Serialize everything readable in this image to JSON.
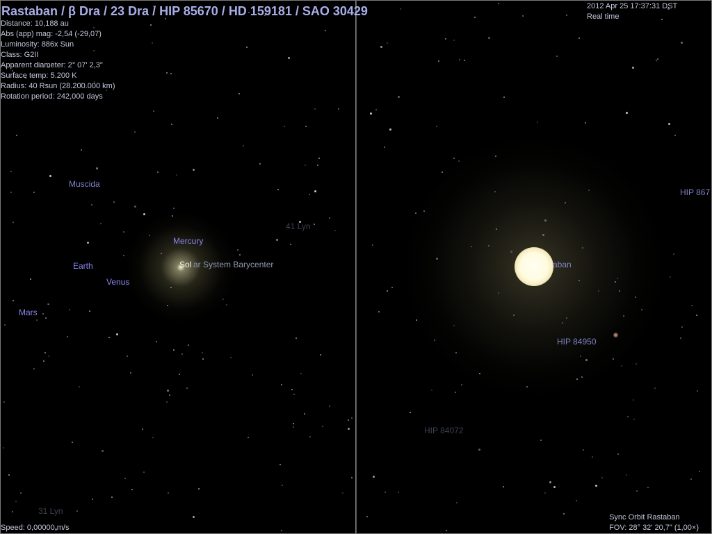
{
  "title": "Rastaban / β Dra / 23 Dra / HIP 85670 / HD 159181 / SAO 30429",
  "info": {
    "distance": "Distance: 10,188 au",
    "magnitude": "Abs (app) mag: -2,54 (-29,07)",
    "luminosity": "Luminosity: 886x Sun",
    "class": "Class: G2II",
    "apparent_diameter": "Apparent diameter: 2° 07' 2,3\"",
    "surface_temp": "Surface temp: 5.200 K",
    "radius": "Radius: 40 Rsun  (28.200.000 km)",
    "rotation_period": "Rotation period: 242,000 days"
  },
  "datetime": {
    "date": "2012 Apr 25 17:37:31 DST",
    "rate": "Real time"
  },
  "status": {
    "speed": "Speed: 0,00000 m/s",
    "sync_orbit": "Sync Orbit Rastaban",
    "fov": "FOV: 28° 32' 20,7\" (1,00×)"
  },
  "left_view": {
    "labels": {
      "muscida": "Muscida",
      "mercury": "Mercury",
      "earth": "Earth",
      "venus": "Venus",
      "mars": "Mars",
      "bary_left": "Sol",
      "bary_right": "ar System Barycenter",
      "lyn_upper": "41 Lyn",
      "lyn_lower": "31 Lyn"
    }
  },
  "right_view": {
    "labels": {
      "rastaban": "aban",
      "hip84950": "HIP 84950",
      "hip84072": "HIP 84072",
      "hip_edge": "HIP 867"
    }
  },
  "colors": {
    "background": "#000000",
    "title": "#a9aee8",
    "info_text": "#c4c8dc",
    "planet_label": "#8a86f0",
    "star_label": "#7f82c8",
    "divider": "#7a7a7a"
  }
}
